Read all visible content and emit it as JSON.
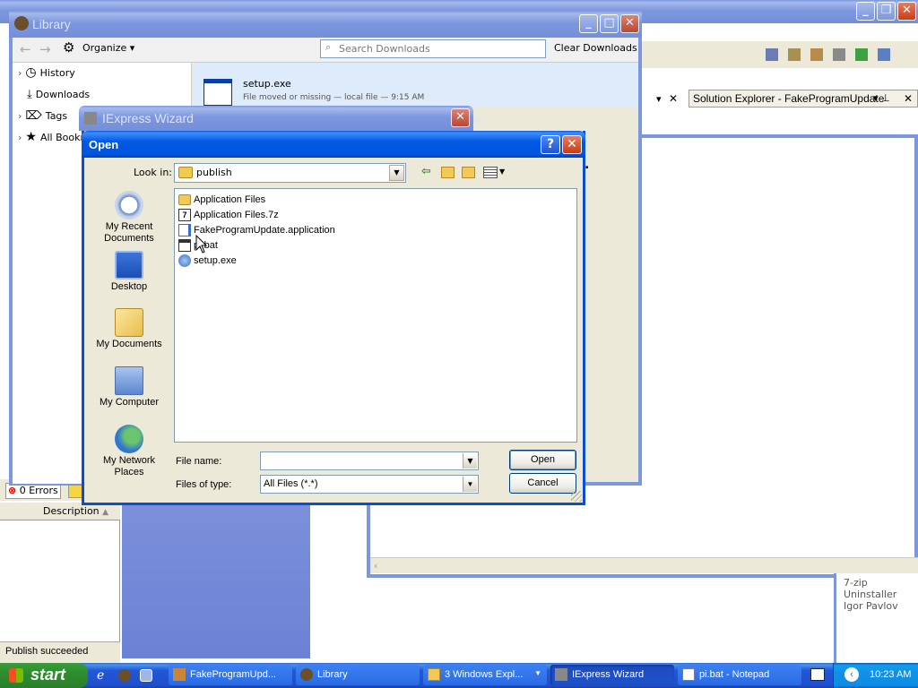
{
  "background_app": {
    "title": "",
    "solution_explorer_title": "Solution Explorer - FakeProgramUpdate",
    "errors_tab": "0 Errors",
    "description_header": "Description",
    "status": "Publish succeeded",
    "add_remove_item": "7-zip Uninstaller",
    "add_remove_sub": "Igor Pavlov"
  },
  "library": {
    "title": "Library",
    "organize_label": "Organize",
    "search_placeholder": "Search Downloads",
    "clear_label": "Clear Downloads",
    "nav": [
      {
        "label": "History"
      },
      {
        "label": "Downloads"
      },
      {
        "label": "Tags"
      },
      {
        "label": "All Bookmarks"
      }
    ],
    "download": {
      "name": "setup.exe",
      "status": "File moved or missing — local file — 9:15 AM"
    }
  },
  "iexpress": {
    "title": "IExpress Wizard",
    "title_tail": "d",
    "body_text": "."
  },
  "open_dialog": {
    "title": "Open",
    "help_label": "?",
    "close_label": "✕",
    "look_in_label": "Look in:",
    "look_in_value": "publish",
    "places": [
      {
        "label": "My Recent Documents",
        "icon": "recent-documents-icon"
      },
      {
        "label": "Desktop",
        "icon": "desktop-icon"
      },
      {
        "label": "My Documents",
        "icon": "my-documents-icon"
      },
      {
        "label": "My Computer",
        "icon": "my-computer-icon"
      },
      {
        "label": "My Network Places",
        "icon": "network-places-icon"
      }
    ],
    "files": [
      {
        "name": "Application Files",
        "icon": "folder-icon"
      },
      {
        "name": "Application Files.7z",
        "icon": "7z-archive-icon"
      },
      {
        "name": "FakeProgramUpdate.application",
        "icon": "application-manifest-icon"
      },
      {
        "name": "pi.bat",
        "icon": "batch-file-icon"
      },
      {
        "name": "setup.exe",
        "icon": "setup-exe-icon"
      }
    ],
    "file_name_label": "File name:",
    "file_name_value": "",
    "files_of_type_label": "Files of type:",
    "files_of_type_value": "All Files (*.*)",
    "open_button": "Open",
    "cancel_button": "Cancel"
  },
  "taskbar": {
    "start_label": "start",
    "tasks": [
      {
        "label": "FakeProgramUpd..."
      },
      {
        "label": "Library"
      },
      {
        "label": "3 Windows Expl..."
      },
      {
        "label": "IExpress Wizard"
      },
      {
        "label": "pi.bat - Notepad"
      }
    ],
    "clock": "10:23 AM"
  },
  "colors": {
    "xp_blue": "#0055DC",
    "start_green": "#2D8E2D",
    "dialog_face": "#ECE9D8"
  }
}
